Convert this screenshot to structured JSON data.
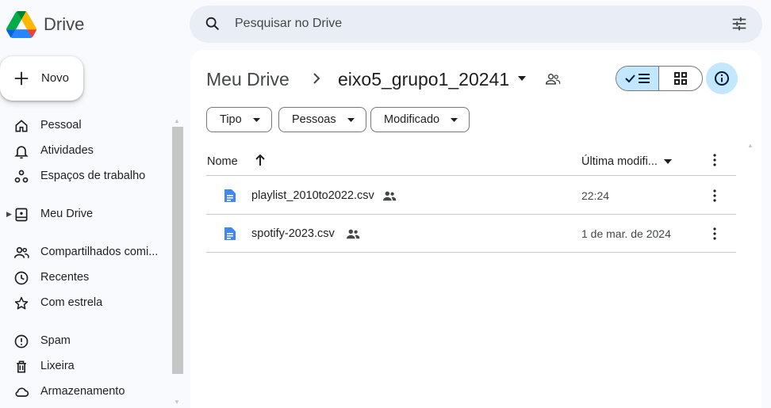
{
  "app": {
    "title": "Drive"
  },
  "search": {
    "placeholder": "Pesquisar no Drive"
  },
  "new_button": {
    "label": "Novo"
  },
  "sidebar": {
    "items": [
      {
        "label": "Pessoal",
        "icon": "home-icon"
      },
      {
        "label": "Atividades",
        "icon": "bell-icon"
      },
      {
        "label": "Espaços de trabalho",
        "icon": "workspaces-icon"
      },
      {
        "label": "Meu Drive",
        "icon": "my-drive-icon"
      },
      {
        "label": "Compartilhados comi...",
        "icon": "shared-people-icon"
      },
      {
        "label": "Recentes",
        "icon": "clock-icon"
      },
      {
        "label": "Com estrela",
        "icon": "star-icon"
      },
      {
        "label": "Spam",
        "icon": "spam-icon"
      },
      {
        "label": "Lixeira",
        "icon": "trash-icon"
      },
      {
        "label": "Armazenamento",
        "icon": "cloud-icon"
      }
    ]
  },
  "breadcrumb": {
    "root": "Meu Drive",
    "current": "eixo5_grupo1_20241"
  },
  "filters": {
    "type": "Tipo",
    "people": "Pessoas",
    "modified": "Modificado"
  },
  "table": {
    "headers": {
      "name": "Nome",
      "modified": "Última modifi..."
    },
    "rows": [
      {
        "name": "playlist_2010to2022.csv",
        "modified": "22:24"
      },
      {
        "name": "spotify-2023.csv",
        "modified": "1 de mar. de 2024"
      }
    ]
  },
  "colors": {
    "accent": "#c2e7ff",
    "doc_blue": "#4285f4",
    "background": "#f8fafd"
  }
}
